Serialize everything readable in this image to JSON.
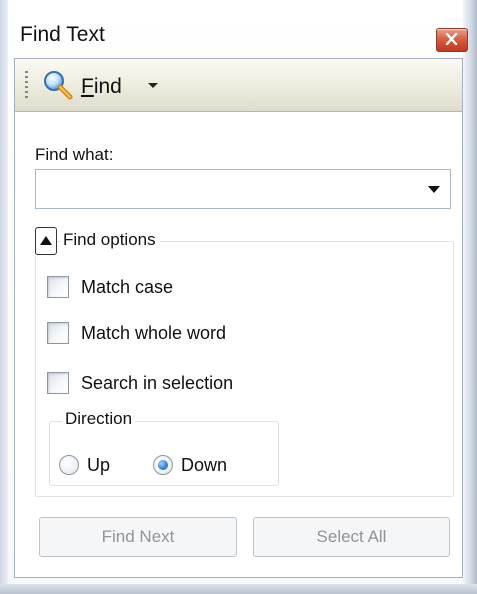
{
  "window": {
    "title": "Find Text"
  },
  "toolbar": {
    "find_label_access": "F",
    "find_label_rest": "ind"
  },
  "find_what": {
    "label": "Find what:",
    "value": ""
  },
  "find_options": {
    "label": "Find options",
    "expanded": true,
    "checkboxes": [
      {
        "label": "Match case",
        "checked": false
      },
      {
        "label": "Match whole word",
        "checked": false
      },
      {
        "label": "Search in selection",
        "checked": false
      }
    ],
    "direction": {
      "label": "Direction",
      "options": [
        {
          "label": "Up",
          "selected": false
        },
        {
          "label": "Down",
          "selected": true
        }
      ]
    }
  },
  "buttons": {
    "find_next": "Find Next",
    "select_all": "Select All"
  },
  "colors": {
    "accent_radio": "#2f7fd6",
    "close_button": "#c2381c",
    "toolbar_bg": "#ecebdd"
  }
}
